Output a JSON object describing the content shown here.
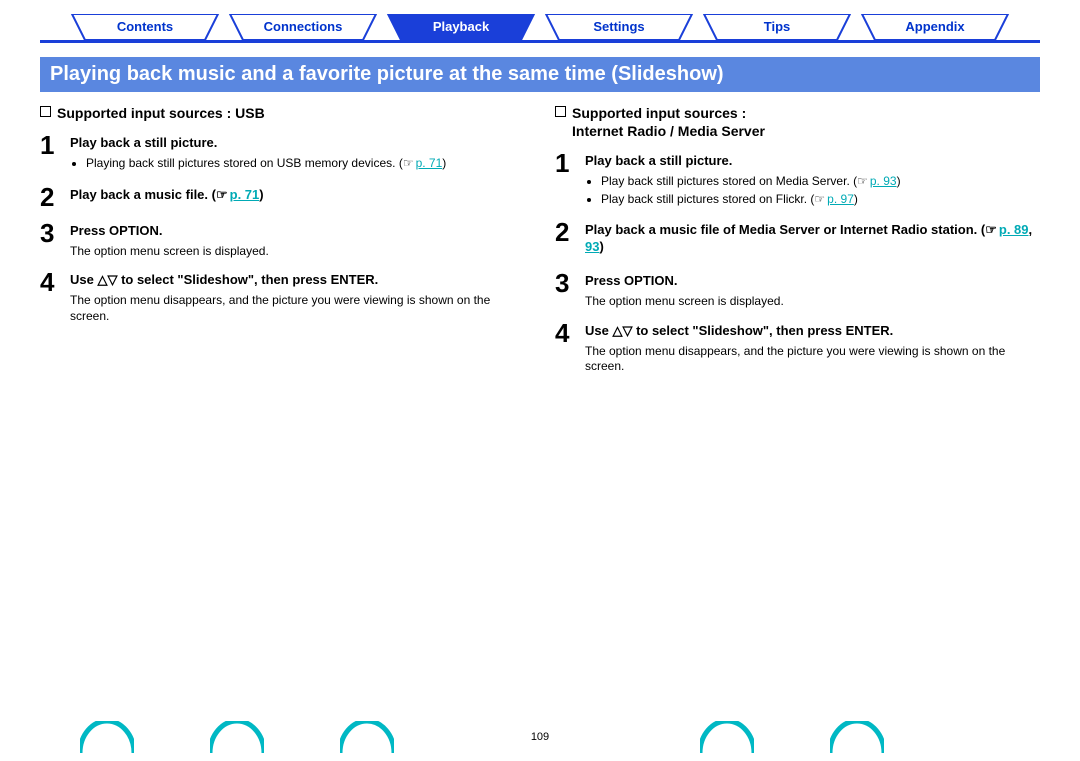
{
  "tabs": {
    "contents": "Contents",
    "connections": "Connections",
    "playback": "Playback",
    "settings": "Settings",
    "tips": "Tips",
    "appendix": "Appendix"
  },
  "title": "Playing back music and a favorite picture at the same time (Slideshow)",
  "left": {
    "heading": "Supported input sources : USB",
    "step1_title": "Play back a still picture.",
    "step1_bullet1_a": "Playing back still pictures stored on USB memory devices.",
    "step1_bullet1_b": "(",
    "step1_link1": "p. 71",
    "step1_bullet1_c": ")",
    "step2_title_a": "Play back a music file.  (",
    "step2_link": "p. 71",
    "step2_title_b": ")",
    "step3_title": "Press OPTION.",
    "step3_body": "The option menu screen is displayed.",
    "step4_title": "Use △▽ to select \"Slideshow\", then press ENTER.",
    "step4_body": "The option menu disappears, and the picture you were viewing is shown on the screen."
  },
  "right": {
    "heading_a": "Supported input sources :",
    "heading_b": "Internet Radio / Media Server",
    "step1_title": "Play back a still picture.",
    "step1_b1_a": "Play back still pictures stored on Media Server.  (",
    "step1_b1_link": "p. 93",
    "step1_b1_b": ")",
    "step1_b2_a": "Play back still pictures stored on Flickr.  (",
    "step1_b2_link": "p. 97",
    "step1_b2_b": ")",
    "step2_title_a": "Play back a music file of Media Server or Internet Radio station.  (",
    "step2_link1": "p. 89",
    "step2_sep": ",  ",
    "step2_link2": "93",
    "step2_title_b": ")",
    "step3_title": "Press OPTION.",
    "step3_body": "The option menu screen is displayed.",
    "step4_title": "Use △▽ to select \"Slideshow\", then press ENTER.",
    "step4_body": "The option menu disappears, and the picture you were viewing is shown on the screen."
  },
  "page_number": "109",
  "nums": {
    "1": "1",
    "2": "2",
    "3": "3",
    "4": "4"
  }
}
